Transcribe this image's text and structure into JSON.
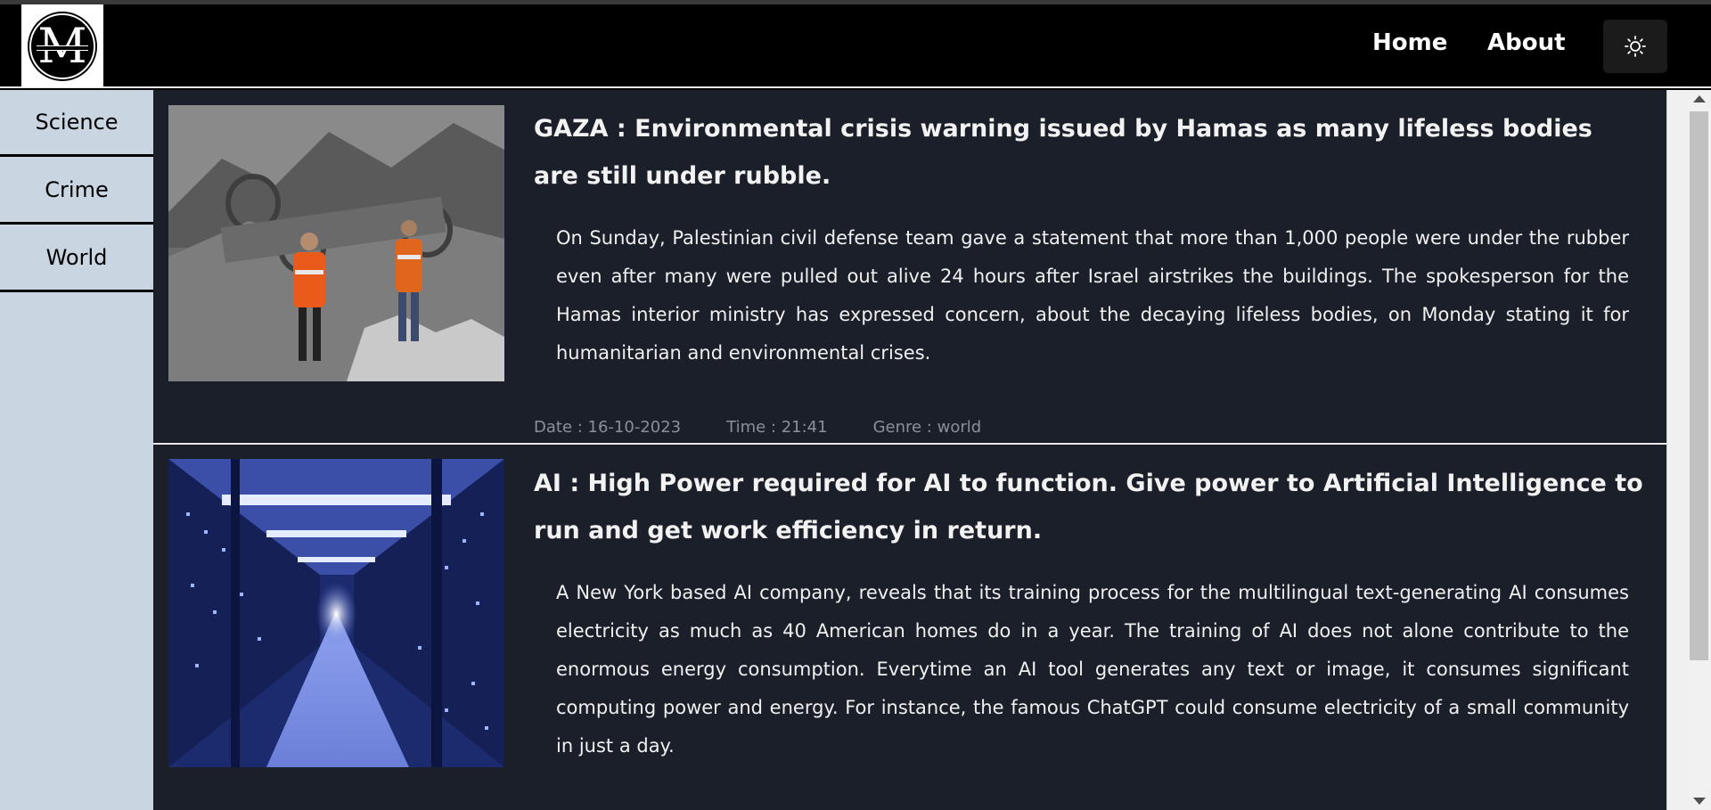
{
  "nav": {
    "logo_letter": "M",
    "links": [
      "Home",
      "About"
    ],
    "theme_icon": "sun-icon"
  },
  "sidebar": {
    "items": [
      {
        "label": "Science"
      },
      {
        "label": "Crime"
      },
      {
        "label": "World"
      }
    ]
  },
  "articles": [
    {
      "title": "GAZA : Environmental crisis warning issued by Hamas as many lifeless bodies are still under rubble.",
      "summary": "On Sunday, Palestinian civil defense team gave a statement that more than 1,000 people were under the rubber even after many were pulled out alive 24 hours after Israel airstrikes the buildings. The spokesperson for the Hamas interior ministry has expressed concern, about the decaying lifeless bodies, on Monday stating it for humanitarian and environmental crises.",
      "date": "Date : 16-10-2023",
      "time": "Time : 21:41",
      "genre": "Genre : world"
    },
    {
      "title": "AI : High Power required for AI to function. Give power to Artificial Intelligence to run and get work efficiency in return.",
      "summary": "A New York based AI company, reveals that its training process for the multilingual text-generating AI consumes electricity as much as 40 American homes do in a year. The training of AI does not alone contribute to the enormous energy consumption. Everytime an AI tool generates any text or image, it consumes significant computing power and energy. For instance, the famous ChatGPT could consume electricity of a small community in just a day."
    }
  ],
  "colors": {
    "navbar_bg": "#000000",
    "sidebar_bg": "#c9d5e1",
    "main_bg": "#1b1f2a",
    "meta_text": "#8c8f96"
  }
}
